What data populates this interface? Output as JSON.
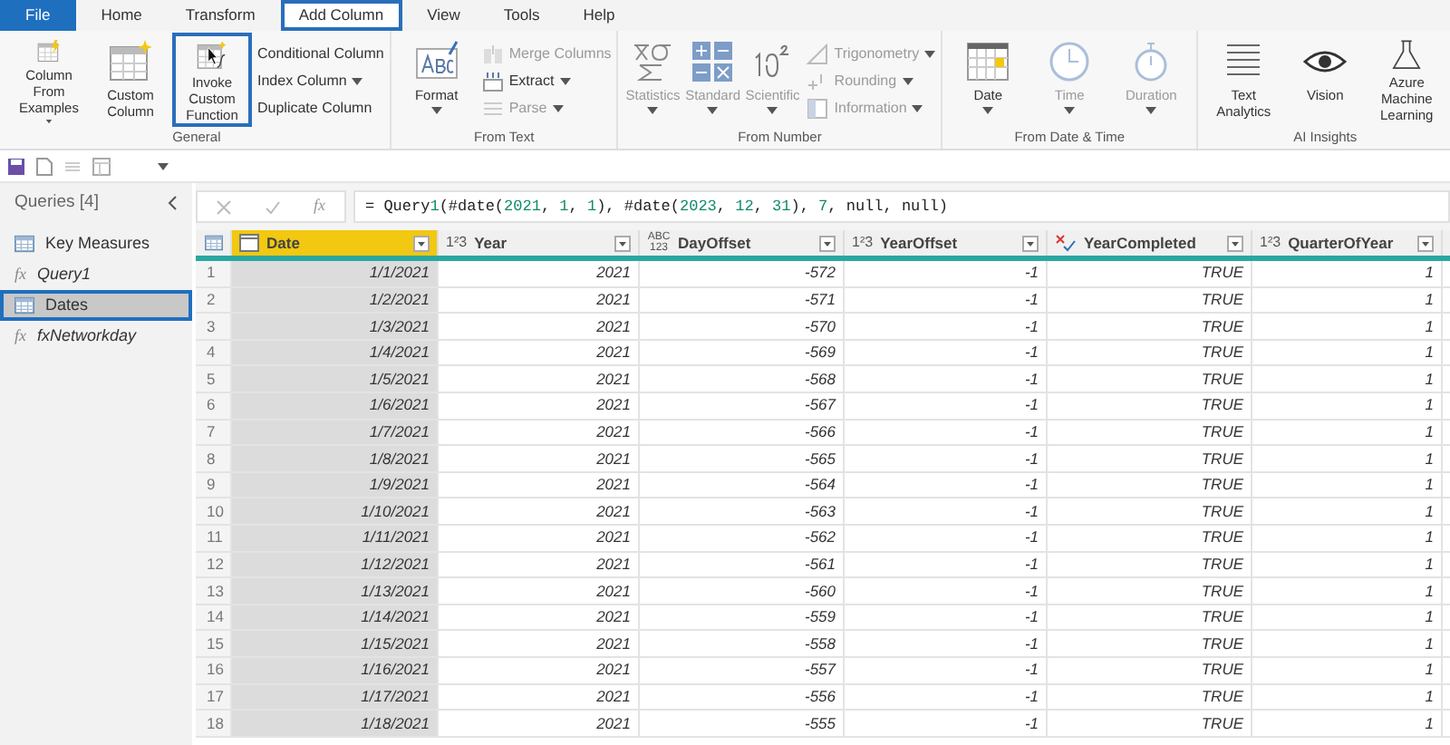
{
  "tabs": [
    {
      "label": "File",
      "kind": "file",
      "selected": false
    },
    {
      "label": "Home",
      "kind": "tab",
      "selected": false
    },
    {
      "label": "Transform",
      "kind": "tab",
      "selected": false
    },
    {
      "label": "Add Column",
      "kind": "tab",
      "selected": true
    },
    {
      "label": "View",
      "kind": "tab",
      "selected": false
    },
    {
      "label": "Tools",
      "kind": "tab",
      "selected": false
    },
    {
      "label": "Help",
      "kind": "tab",
      "selected": false
    }
  ],
  "ribbon_groups": [
    {
      "label": "General",
      "items": [
        {
          "label": "Column From Examples",
          "kind": "large",
          "dropdown": true,
          "disabled": false,
          "highlighted": false
        },
        {
          "label": "Custom Column",
          "kind": "large",
          "dropdown": false,
          "disabled": false,
          "highlighted": false
        },
        {
          "label": "Invoke Custom Function",
          "kind": "large",
          "dropdown": false,
          "disabled": false,
          "highlighted": true
        },
        {
          "label": "Conditional Column",
          "kind": "small",
          "dropdown": false,
          "disabled": false
        },
        {
          "label": "Index Column",
          "kind": "small",
          "dropdown": true,
          "disabled": false
        },
        {
          "label": "Duplicate Column",
          "kind": "small",
          "dropdown": false,
          "disabled": false
        }
      ]
    },
    {
      "label": "From Text",
      "items": [
        {
          "label": "Format",
          "kind": "large",
          "dropdown": true,
          "disabled": false,
          "highlighted": false
        },
        {
          "label": "Merge Columns",
          "kind": "small",
          "dropdown": false,
          "disabled": true
        },
        {
          "label": "Extract",
          "kind": "small",
          "dropdown": true,
          "disabled": false
        },
        {
          "label": "Parse",
          "kind": "small",
          "dropdown": true,
          "disabled": true
        }
      ]
    },
    {
      "label": "From Number",
      "items": [
        {
          "label": "Statistics",
          "kind": "large",
          "dropdown": true,
          "disabled": true,
          "highlighted": false
        },
        {
          "label": "Standard",
          "kind": "large",
          "dropdown": true,
          "disabled": true,
          "highlighted": false
        },
        {
          "label": "Scientific",
          "kind": "large",
          "dropdown": true,
          "disabled": true,
          "highlighted": false
        },
        {
          "label": "Trigonometry",
          "kind": "small",
          "dropdown": true,
          "disabled": true
        },
        {
          "label": "Rounding",
          "kind": "small",
          "dropdown": true,
          "disabled": true
        },
        {
          "label": "Information",
          "kind": "small",
          "dropdown": true,
          "disabled": true
        }
      ]
    },
    {
      "label": "From Date & Time",
      "items": [
        {
          "label": "Date",
          "kind": "large",
          "dropdown": true,
          "disabled": false,
          "highlighted": false
        },
        {
          "label": "Time",
          "kind": "large",
          "dropdown": true,
          "disabled": true,
          "highlighted": false
        },
        {
          "label": "Duration",
          "kind": "large",
          "dropdown": true,
          "disabled": true,
          "highlighted": false
        }
      ]
    },
    {
      "label": "AI Insights",
      "items": [
        {
          "label": "Text Analytics",
          "kind": "large",
          "dropdown": false,
          "disabled": false,
          "highlighted": false
        },
        {
          "label": "Vision",
          "kind": "large",
          "dropdown": false,
          "disabled": false,
          "highlighted": false
        },
        {
          "label": "Azure Machine Learning",
          "kind": "large",
          "dropdown": false,
          "disabled": false,
          "highlighted": false
        }
      ]
    }
  ],
  "queries": {
    "title": "Queries [4]",
    "items": [
      {
        "label": "Key Measures",
        "kind": "table",
        "selected": false
      },
      {
        "label": "Query1",
        "kind": "function",
        "icon": "fx",
        "selected": false
      },
      {
        "label": "Dates",
        "kind": "table",
        "selected": true
      },
      {
        "label": "fxNetworkday",
        "kind": "function",
        "icon": "fx",
        "selected": false
      }
    ]
  },
  "formula_bar": {
    "fx_label": "fx",
    "formula": "= Query1(#date(2021, 1, 1), #date(2023, 12, 31), 7, null, null)"
  },
  "table": {
    "columns": [
      {
        "name": "Date",
        "kind": "date",
        "selected": true
      },
      {
        "name": "Year",
        "kind": "number",
        "type_icon": "1²3",
        "selected": false
      },
      {
        "name": "DayOffset",
        "kind": "any",
        "type_icon": "ABC 123",
        "selected": false
      },
      {
        "name": "YearOffset",
        "kind": "number",
        "type_icon": "1²3",
        "selected": false
      },
      {
        "name": "YearCompleted",
        "kind": "logical",
        "selected": false
      },
      {
        "name": "QuarterOfYear",
        "kind": "number",
        "type_icon": "1²3",
        "selected": false
      }
    ],
    "rows": [
      [
        "1",
        "1/1/2021",
        "2021",
        "-572",
        "-1",
        "TRUE",
        "1"
      ],
      [
        "2",
        "1/2/2021",
        "2021",
        "-571",
        "-1",
        "TRUE",
        "1"
      ],
      [
        "3",
        "1/3/2021",
        "2021",
        "-570",
        "-1",
        "TRUE",
        "1"
      ],
      [
        "4",
        "1/4/2021",
        "2021",
        "-569",
        "-1",
        "TRUE",
        "1"
      ],
      [
        "5",
        "1/5/2021",
        "2021",
        "-568",
        "-1",
        "TRUE",
        "1"
      ],
      [
        "6",
        "1/6/2021",
        "2021",
        "-567",
        "-1",
        "TRUE",
        "1"
      ],
      [
        "7",
        "1/7/2021",
        "2021",
        "-566",
        "-1",
        "TRUE",
        "1"
      ],
      [
        "8",
        "1/8/2021",
        "2021",
        "-565",
        "-1",
        "TRUE",
        "1"
      ],
      [
        "9",
        "1/9/2021",
        "2021",
        "-564",
        "-1",
        "TRUE",
        "1"
      ],
      [
        "10",
        "1/10/2021",
        "2021",
        "-563",
        "-1",
        "TRUE",
        "1"
      ],
      [
        "11",
        "1/11/2021",
        "2021",
        "-562",
        "-1",
        "TRUE",
        "1"
      ],
      [
        "12",
        "1/12/2021",
        "2021",
        "-561",
        "-1",
        "TRUE",
        "1"
      ],
      [
        "13",
        "1/13/2021",
        "2021",
        "-560",
        "-1",
        "TRUE",
        "1"
      ],
      [
        "14",
        "1/14/2021",
        "2021",
        "-559",
        "-1",
        "TRUE",
        "1"
      ],
      [
        "15",
        "1/15/2021",
        "2021",
        "-558",
        "-1",
        "TRUE",
        "1"
      ],
      [
        "16",
        "1/16/2021",
        "2021",
        "-557",
        "-1",
        "TRUE",
        "1"
      ],
      [
        "17",
        "1/17/2021",
        "2021",
        "-556",
        "-1",
        "TRUE",
        "1"
      ],
      [
        "18",
        "1/18/2021",
        "2021",
        "-555",
        "-1",
        "TRUE",
        "1"
      ]
    ]
  }
}
